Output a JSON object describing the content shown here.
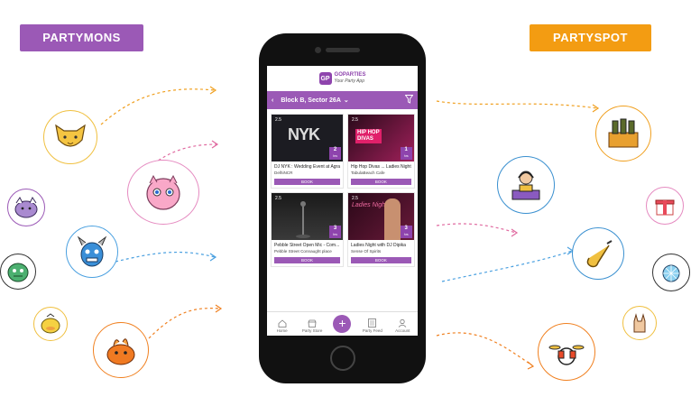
{
  "labels": {
    "left": "PARTYMONS",
    "right": "PARTYSPOT"
  },
  "app": {
    "logo_mark": "GP",
    "logo_name": "GOPARTIES",
    "logo_tagline": "Your Party App",
    "location": "Block B, Sector 26A",
    "events": [
      {
        "rating": "2.5",
        "hours": "2",
        "hours_unit": "hrs",
        "title": "DJ NYK : Wedding Event at Agra",
        "venue": "DelhiNCR",
        "book": "BOOK",
        "thumb": "#1c1c22"
      },
      {
        "rating": "2.5",
        "hours": "1",
        "hours_unit": "hrs",
        "title": "Hip Hop Divas ... Ladies Night",
        "venue": "TabulaBeach Cafe",
        "book": "BOOK",
        "thumb": "#7a1a4a"
      },
      {
        "rating": "2.5",
        "hours": "3",
        "hours_unit": "hrs",
        "title": "Pebble Street Open Mic - Com...",
        "venue": "Pebble Street Connaught place",
        "book": "BOOK",
        "thumb": "#2a2a2a"
      },
      {
        "rating": "2.5",
        "hours": "3",
        "hours_unit": "hrs",
        "title": "Ladies Night with DJ Dipika",
        "venue": "Sense Of Spirits",
        "book": "BOOK",
        "thumb": "#3a0e2a"
      }
    ],
    "tabs": [
      {
        "label": "Home"
      },
      {
        "label": "Party Store"
      },
      {
        "label": ""
      },
      {
        "label": "Party Feed"
      },
      {
        "label": "Account"
      }
    ]
  },
  "colors": {
    "purple": "#9b59b6",
    "orange": "#f39c12"
  },
  "left_icons": [
    "fox-pokemon-icon",
    "jigglypuff-icon",
    "purple-creature-icon",
    "blue-creature-icon",
    "green-creature-icon",
    "yellow-duck-icon",
    "orange-creature-icon"
  ],
  "right_icons": [
    "bottles-crate-icon",
    "dj-icon",
    "gift-icon",
    "guitar-icon",
    "disco-ball-icon",
    "rock-hand-icon",
    "drum-kit-icon"
  ]
}
